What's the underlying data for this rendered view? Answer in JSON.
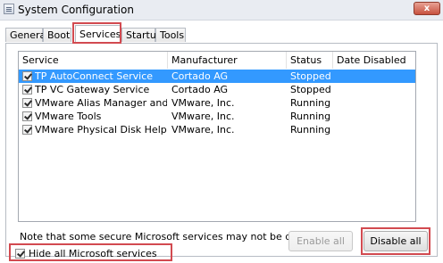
{
  "window": {
    "title": "System Configuration",
    "close_glyph": "x"
  },
  "tabs": [
    {
      "label": "General"
    },
    {
      "label": "Boot"
    },
    {
      "label": "Services"
    },
    {
      "label": "Startup"
    },
    {
      "label": "Tools"
    }
  ],
  "active_tab": "Services",
  "services": {
    "columns": [
      "Service",
      "Manufacturer",
      "Status",
      "Date Disabled"
    ],
    "rows": [
      {
        "checked": true,
        "service": "TP AutoConnect Service",
        "manufacturer": "Cortado AG",
        "status": "Stopped",
        "date_disabled": "",
        "selected": true
      },
      {
        "checked": true,
        "service": "TP VC Gateway Service",
        "manufacturer": "Cortado AG",
        "status": "Stopped",
        "date_disabled": ""
      },
      {
        "checked": true,
        "service": "VMware Alias Manager and Ticke...",
        "manufacturer": "VMware, Inc.",
        "status": "Running",
        "date_disabled": ""
      },
      {
        "checked": true,
        "service": "VMware Tools",
        "manufacturer": "VMware, Inc.",
        "status": "Running",
        "date_disabled": ""
      },
      {
        "checked": true,
        "service": "VMware Physical Disk Helper Ser...",
        "manufacturer": "VMware, Inc.",
        "status": "Running",
        "date_disabled": ""
      }
    ]
  },
  "note": "Note that some secure Microsoft services may not be disabled.",
  "buttons": {
    "enable_all": "Enable all",
    "disable_all": "Disable all"
  },
  "hide_microsoft": {
    "checked": true,
    "label": "Hide all Microsoft services"
  },
  "colors": {
    "highlight": "#d24a50",
    "selection": "#3399ff"
  }
}
